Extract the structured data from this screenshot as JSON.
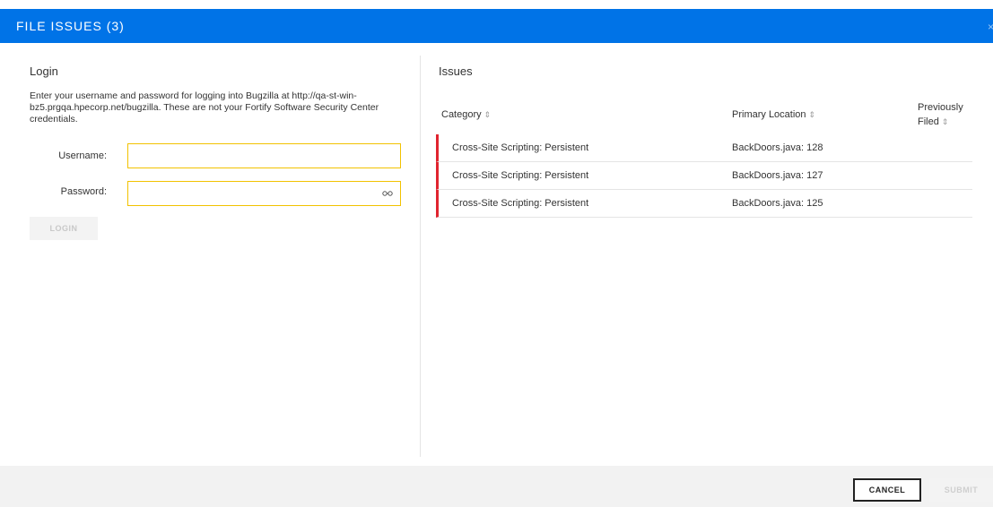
{
  "header": {
    "title": "FILE ISSUES (3)",
    "close_glyph": "×"
  },
  "login": {
    "title": "Login",
    "description": "Enter your username and password for logging into Bugzilla at http://qa-st-win-bz5.prgqa.hpecorp.net/bugzilla. These are not your Fortify Software Security Center credentials.",
    "username_label": "Username:",
    "username_value": "",
    "password_label": "Password:",
    "password_value": "",
    "password_icon": "eye-icon",
    "login_label": "LOGIN"
  },
  "issues": {
    "title": "Issues",
    "columns": {
      "category": "Category",
      "location": "Primary Location",
      "filed_line1": "Previously",
      "filed_line2": "Filed",
      "sort_glyph": "⇕"
    },
    "rows": [
      {
        "category": "Cross-Site Scripting: Persistent",
        "location": "BackDoors.java: 128"
      },
      {
        "category": "Cross-Site Scripting: Persistent",
        "location": "BackDoors.java: 127"
      },
      {
        "category": "Cross-Site Scripting: Persistent",
        "location": "BackDoors.java: 125"
      }
    ],
    "severity_color": "#e0242f"
  },
  "footer": {
    "cancel_label": "CANCEL",
    "submit_label": "SUBMIT"
  },
  "colors": {
    "header_bg": "#0073e7",
    "input_border": "#f2c200",
    "footer_bg": "#f2f2f2"
  }
}
